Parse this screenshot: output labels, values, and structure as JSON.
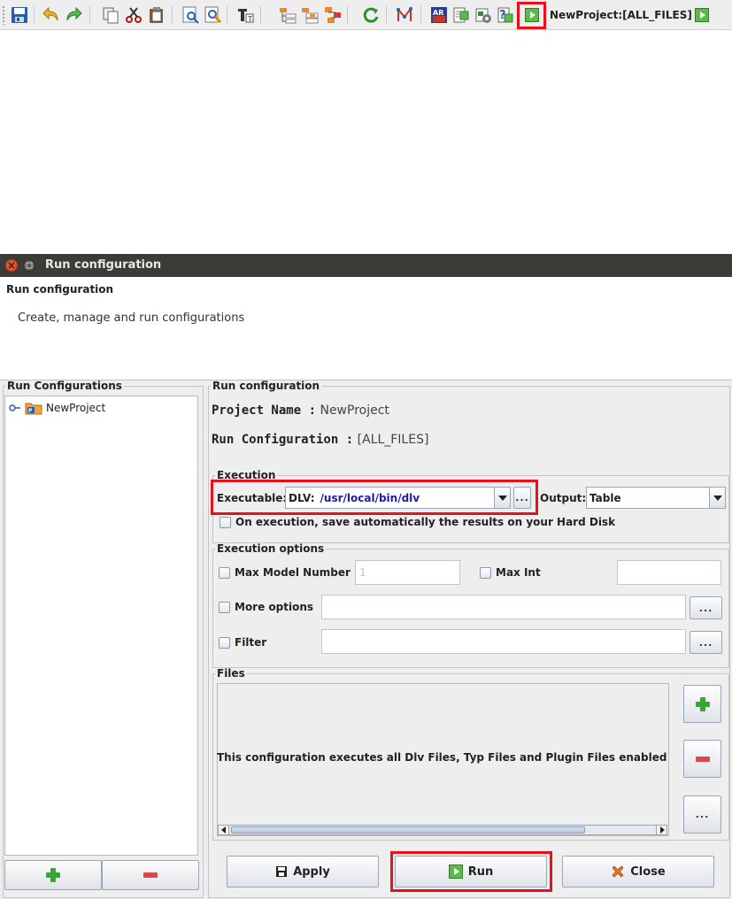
{
  "toolbar": {
    "project_label": "NewProject:[ALL_FILES]",
    "icons": [
      "save-icon",
      "undo-icon",
      "redo-icon",
      "copy-icon",
      "cut-icon",
      "paste-icon",
      "find-icon",
      "find-replace-icon",
      "font-icon",
      "tree-expand-icon",
      "tree-collapse-icon",
      "tree-icon",
      "refresh-icon",
      "graph-icon",
      "ar-vis-icon",
      "export-icon",
      "plugin-icon",
      "help-icon",
      "run-icon"
    ]
  },
  "dialog": {
    "window_title": "Run configuration",
    "header_title": "Run configuration",
    "header_subtitle": "Create, manage and run configurations",
    "left_panel": {
      "legend": "Run Configurations",
      "tree_items": [
        {
          "label": "NewProject"
        }
      ]
    },
    "right_panel": {
      "legend": "Run configuration",
      "project_name_label": "Project Name :",
      "project_name_value": "NewProject",
      "run_config_label": "Run Configuration :",
      "run_config_value": "[ALL_FILES]",
      "execution": {
        "legend": "Execution",
        "executable_label": "Executable:",
        "executable_prefix": "DLV:",
        "executable_value": "/usr/local/bin/dlv",
        "browse_label": "...",
        "output_label": "Output:",
        "output_value": "Table",
        "save_checkbox_label": "On execution, save automatically the results on your Hard Disk"
      },
      "options": {
        "legend": "Execution options",
        "max_model_label": "Max Model Number",
        "max_model_value": "1",
        "max_int_label": "Max Int",
        "max_int_value": "",
        "more_options_label": "More options",
        "more_options_value": "",
        "filter_label": "Filter",
        "filter_value": "",
        "browse_label": "..."
      },
      "files": {
        "legend": "Files",
        "message": "This configuration executes all Dlv Files, Typ Files and Plugin Files enabled",
        "browse_label": "..."
      }
    },
    "buttons": {
      "apply": "Apply",
      "run": "Run",
      "close": "Close"
    }
  },
  "colors": {
    "highlight": "#e8101a",
    "titlebar": "#3d3b37",
    "executable_text": "#1c1ca8"
  }
}
